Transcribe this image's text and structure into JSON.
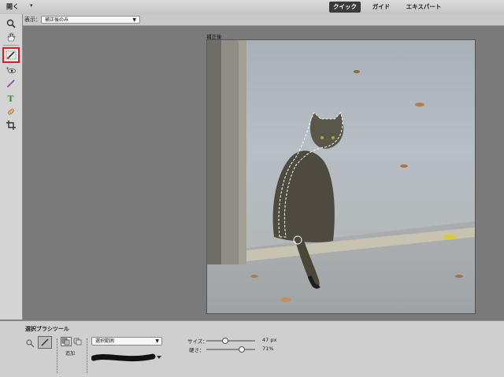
{
  "topbar": {
    "open_label": "開く",
    "open_caret": "▾",
    "tabs": [
      {
        "label": "クイック",
        "active": true
      },
      {
        "label": "ガイド",
        "active": false
      },
      {
        "label": "エキスパート",
        "active": false
      }
    ]
  },
  "options": {
    "view_label": "表示：",
    "view_value": "補正後のみ"
  },
  "toolbar": {
    "tools": [
      {
        "icon": "zoom-icon",
        "selected": false
      },
      {
        "icon": "hand-icon",
        "selected": false
      },
      {
        "icon": "quick-selection-brush-icon",
        "selected": true
      },
      {
        "icon": "red-eye-icon",
        "selected": false
      },
      {
        "icon": "whiten-teeth-icon",
        "selected": false
      },
      {
        "icon": "type-icon",
        "selected": false
      },
      {
        "icon": "spot-healing-icon",
        "selected": false
      },
      {
        "icon": "crop-icon",
        "selected": false
      }
    ]
  },
  "canvas": {
    "label": "補正後"
  },
  "tool_options": {
    "title": "選択ブラシツール",
    "add_label": "追加",
    "brush_mode_value": "選択範囲",
    "size_label": "サイズ：",
    "size_value": "47 px",
    "size_level": 0.38,
    "hardness_label": "硬さ：",
    "hardness_value": "71%",
    "hardness_level": 0.71
  },
  "colors": {
    "selected_tool_border": "#d42020",
    "active_tab": "#3a3a3a"
  }
}
